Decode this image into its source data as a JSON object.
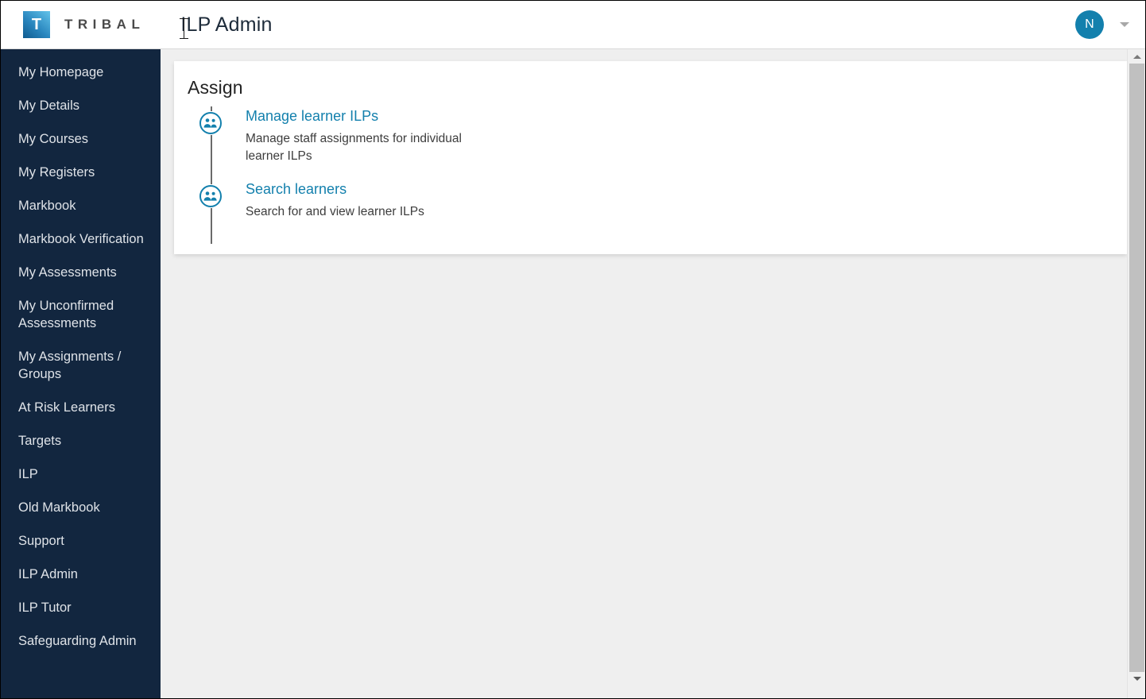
{
  "header": {
    "logo_letter": "T",
    "brand_name": "TRIBAL",
    "app_title": "ILP Admin",
    "avatar_initial": "N",
    "caret_icon": "chevron-down-icon",
    "brand_gradient_from": "#0f5b8f",
    "brand_gradient_to": "#63c3ea",
    "avatar_color": "#1380ad"
  },
  "sidebar": {
    "background": "#12263f",
    "text_color": "#dfe3e8",
    "items": [
      {
        "label": "My Homepage"
      },
      {
        "label": "My Details"
      },
      {
        "label": "My Courses"
      },
      {
        "label": "My Registers"
      },
      {
        "label": "Markbook"
      },
      {
        "label": "Markbook Verification"
      },
      {
        "label": "My Assessments"
      },
      {
        "label": "My Unconfirmed Assessments"
      },
      {
        "label": "My Assignments / Groups"
      },
      {
        "label": "At Risk Learners"
      },
      {
        "label": "Targets"
      },
      {
        "label": "ILP"
      },
      {
        "label": "Old Markbook"
      },
      {
        "label": "Support"
      },
      {
        "label": "ILP Admin"
      },
      {
        "label": "ILP Tutor"
      },
      {
        "label": "Safeguarding Admin"
      }
    ]
  },
  "main": {
    "card": {
      "title": "Assign",
      "link_color": "#1380ad",
      "items": [
        {
          "icon": "users-group-circle-icon",
          "link": "Manage learner ILPs",
          "description": "Manage staff assignments for individual learner ILPs"
        },
        {
          "icon": "users-group-circle-icon",
          "link": "Search learners",
          "description": "Search for and view learner ILPs"
        }
      ]
    }
  },
  "scrollbar": {
    "up_icon": "triangle-up-icon",
    "down_icon": "triangle-down-icon"
  }
}
